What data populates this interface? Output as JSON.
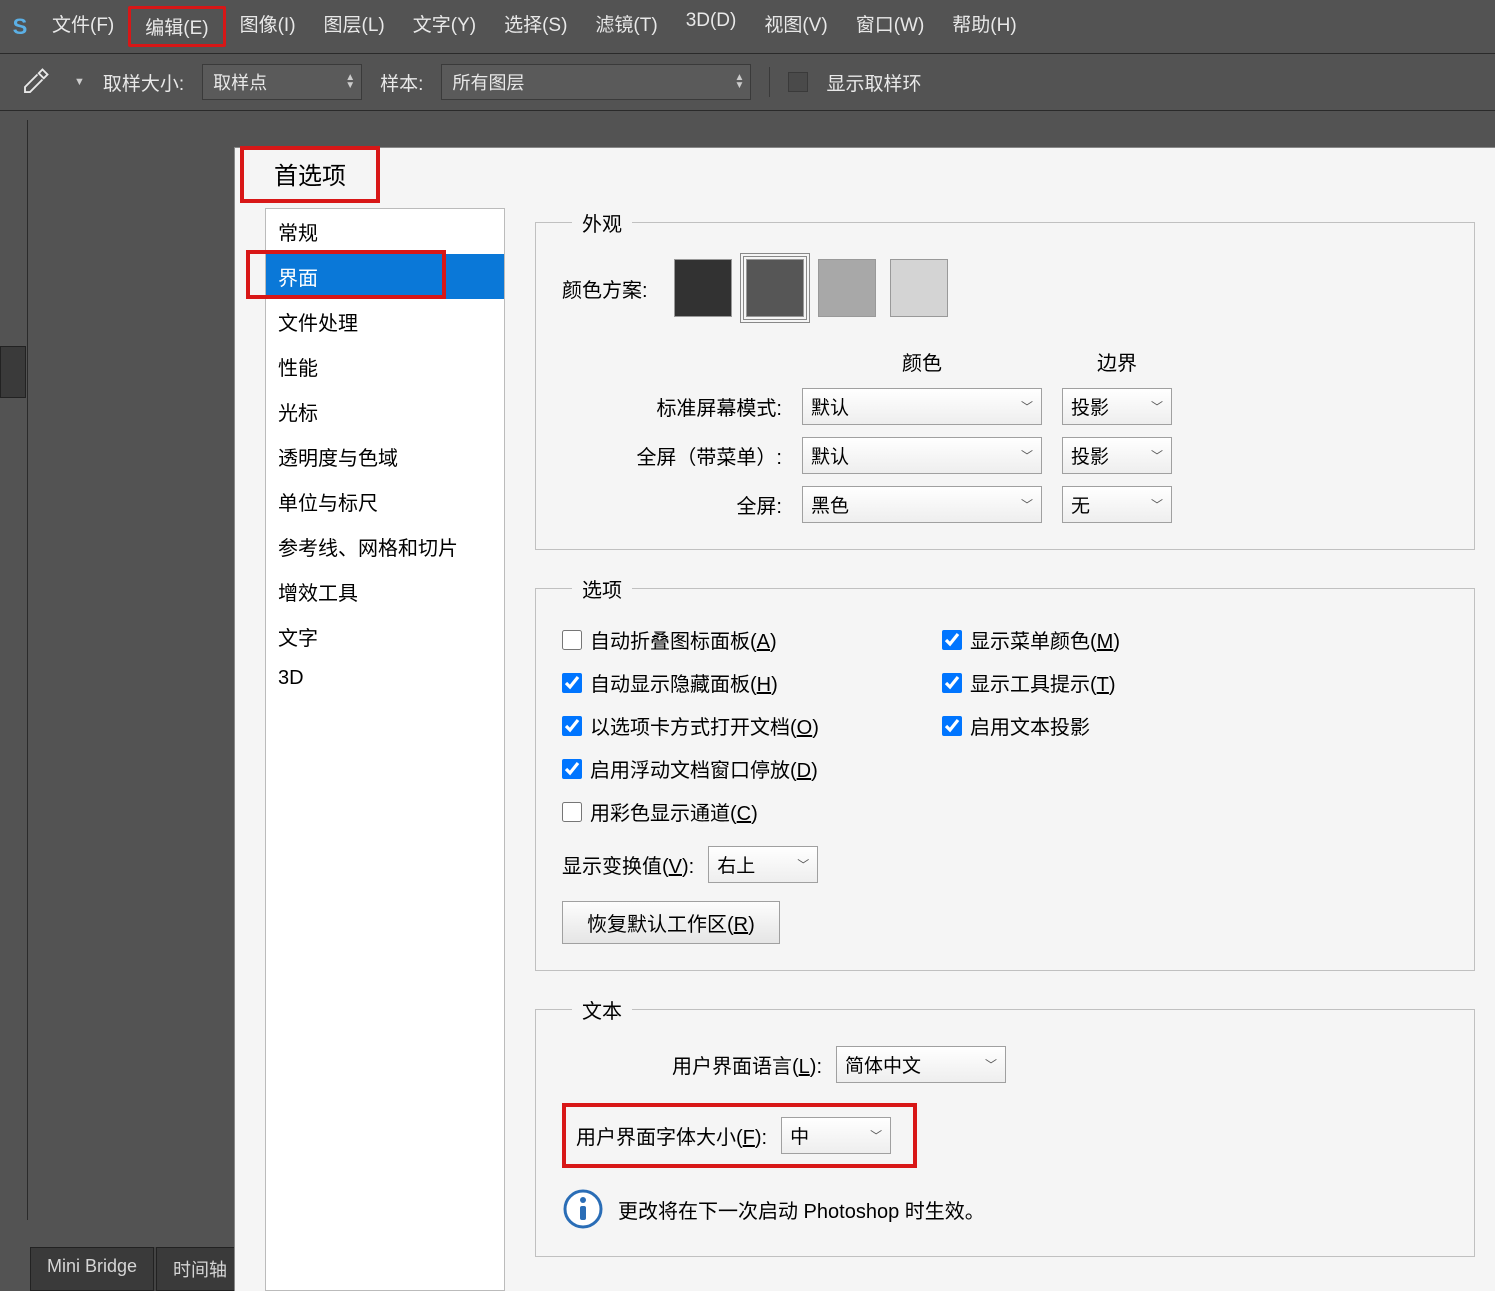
{
  "menubar": {
    "items": [
      "文件(F)",
      "编辑(E)",
      "图像(I)",
      "图层(L)",
      "文字(Y)",
      "选择(S)",
      "滤镜(T)",
      "3D(D)",
      "视图(V)",
      "窗口(W)",
      "帮助(H)"
    ],
    "highlight_index": 1
  },
  "optbar": {
    "sample_size_label": "取样大小:",
    "sample_size_value": "取样点",
    "sample_label": "样本:",
    "sample_value": "所有图层",
    "ring_label": "显示取样环"
  },
  "bottomtabs": [
    "Mini Bridge",
    "时间轴"
  ],
  "dialog": {
    "title": "首选项",
    "sidebar": {
      "items": [
        "常规",
        "界面",
        "文件处理",
        "性能",
        "光标",
        "透明度与色域",
        "单位与标尺",
        "参考线、网格和切片",
        "增效工具",
        "文字",
        "3D"
      ],
      "selected_index": 1
    },
    "appearance": {
      "legend": "外观",
      "swatch_label": "颜色方案:",
      "swatches": [
        "#323232",
        "#565656",
        "#a8a8a8",
        "#d4d4d4"
      ],
      "swatch_selected": 1,
      "col_headers": [
        "颜色",
        "边界"
      ],
      "rows": [
        {
          "label": "标准屏幕模式:",
          "color": "默认",
          "border": "投影"
        },
        {
          "label": "全屏（带菜单）:",
          "color": "默认",
          "border": "投影"
        },
        {
          "label": "全屏:",
          "color": "黑色",
          "border": "无"
        }
      ]
    },
    "options": {
      "legend": "选项",
      "checks_left": [
        {
          "label": "自动折叠图标面板",
          "accel": "A",
          "checked": false
        },
        {
          "label": "自动显示隐藏面板",
          "accel": "H",
          "checked": true
        },
        {
          "label": "以选项卡方式打开文档",
          "accel": "O",
          "checked": true
        },
        {
          "label": "启用浮动文档窗口停放",
          "accel": "D",
          "checked": true
        },
        {
          "label": "用彩色显示通道",
          "accel": "C",
          "checked": false
        }
      ],
      "checks_right": [
        {
          "label": "显示菜单颜色",
          "accel": "M",
          "checked": true
        },
        {
          "label": "显示工具提示",
          "accel": "T",
          "checked": true
        },
        {
          "label": "启用文本投影",
          "accel": "",
          "checked": true
        }
      ],
      "transform_label": "显示变换值",
      "transform_accel": "V",
      "transform_value": "右上",
      "reset_button": "恢复默认工作区",
      "reset_accel": "R"
    },
    "text": {
      "legend": "文本",
      "lang_label": "用户界面语言",
      "lang_accel": "L",
      "lang_value": "简体中文",
      "fontsize_label": "用户界面字体大小",
      "fontsize_accel": "F",
      "fontsize_value": "中",
      "info": "更改将在下一次启动 Photoshop 时生效。"
    }
  }
}
